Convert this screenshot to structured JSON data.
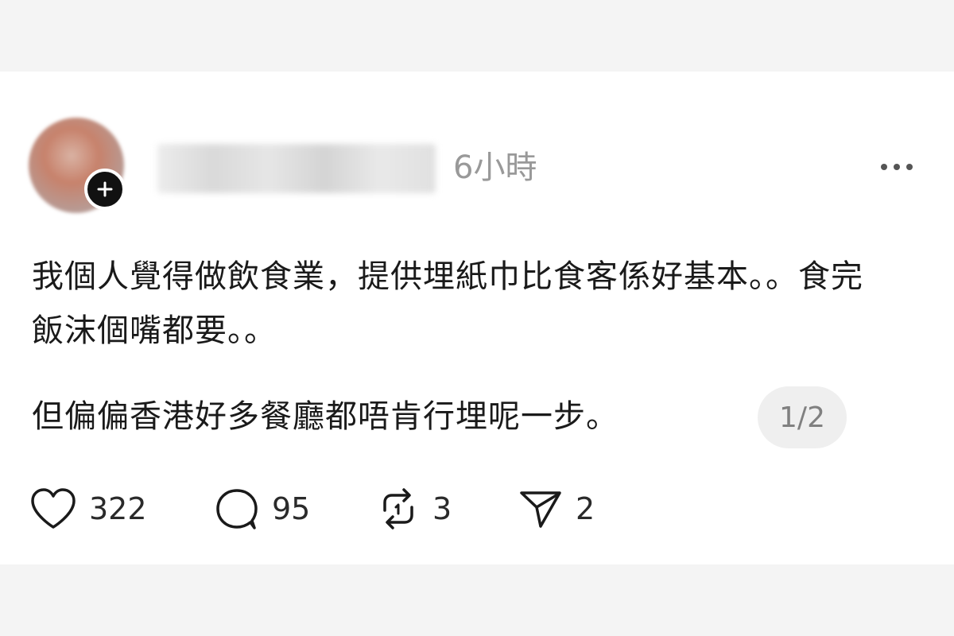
{
  "post": {
    "time": "6小時",
    "paragraph_1": "我個人覺得做飲食業，提供埋紙巾比食客係好基本。。食完飯沫個嘴都要。。",
    "paragraph_2": "但偏偏香港好多餐廳都唔肯行埋呢一步。",
    "page_indicator": "1/2"
  },
  "actions": {
    "likes": "322",
    "comments": "95",
    "reposts": "3",
    "shares": "2"
  },
  "icons": {
    "follow": "plus-icon",
    "more": "more-horizontal-icon",
    "like": "heart-icon",
    "comment": "comment-bubble-icon",
    "repost": "repost-icon",
    "share": "send-icon"
  }
}
